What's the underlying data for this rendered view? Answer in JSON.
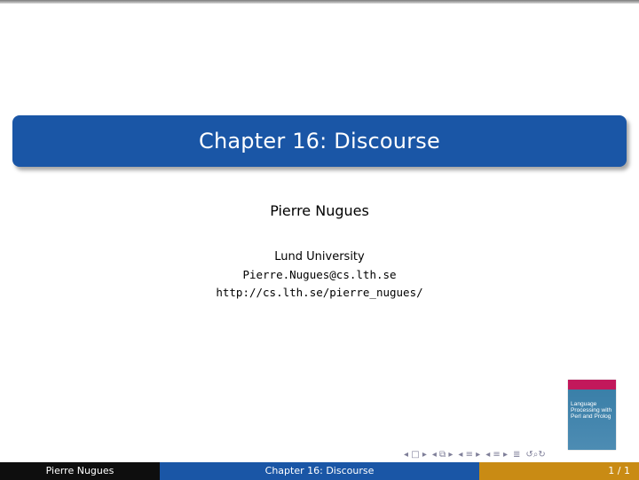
{
  "slide": {
    "title": "Chapter 16: Discourse",
    "author": "Pierre Nugues",
    "institution": "Lund University",
    "email": "Pierre.Nugues@cs.lth.se",
    "url": "http://cs.lth.se/pierre_nugues/"
  },
  "book_cover": {
    "title_line1": "Language",
    "title_line2": "Processing with",
    "title_line3": "Perl and Prolog"
  },
  "navigation": {
    "icons": [
      "nav-first-icon",
      "nav-prev-icon",
      "nav-frame-icon",
      "nav-section-icon",
      "nav-subsection-icon",
      "nav-next-icon",
      "nav-search-icon"
    ]
  },
  "footer": {
    "author": "Pierre Nugues",
    "title": "Chapter 16: Discourse",
    "page": "1 / 1"
  },
  "colors": {
    "title_bg": "#1a56a6",
    "footer_left": "#0e0e0e",
    "footer_mid": "#1a56a6",
    "footer_right": "#c98b14"
  }
}
